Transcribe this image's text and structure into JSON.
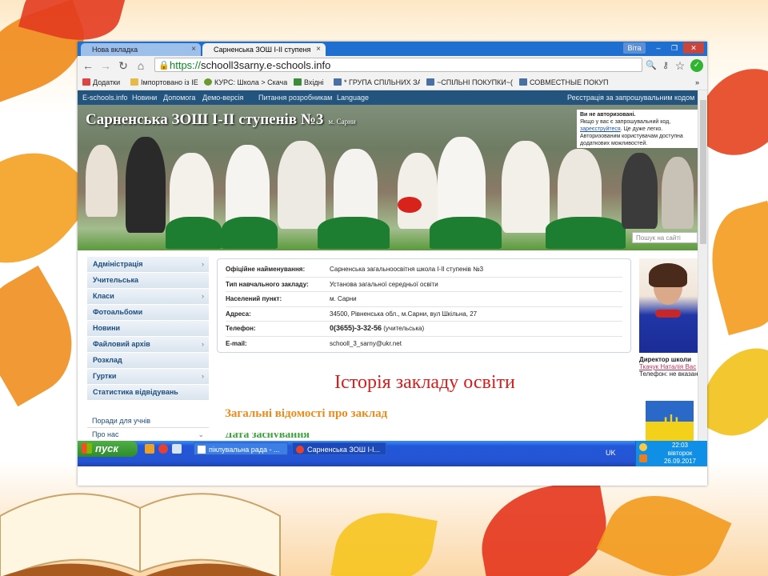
{
  "browser": {
    "tabs": [
      {
        "label": "Нова вкладка"
      },
      {
        "label": "Сарненська ЗОШ І-ІІ ступеня"
      }
    ],
    "user_badge": "Віта",
    "url_scheme": "https://",
    "url_host": "schooll3sarny.e-schools.info",
    "bookmarks": [
      {
        "label": "Додатки"
      },
      {
        "label": "Імпортовано із IE"
      },
      {
        "label": "КУРС: Школа > Скача"
      },
      {
        "label": "Вхідні"
      },
      {
        "label": "* ГРУПА СПІЛЬНИХ ЗА"
      },
      {
        "label": "~СПІЛЬНІ ПОКУПКИ~("
      },
      {
        "label": "СОВМЕСТНЫЕ ПОКУПК"
      }
    ],
    "more": "»"
  },
  "site_nav": {
    "items": [
      "E-schools.info",
      "Новини",
      "Допомога",
      "Демо-версія",
      "Питання розробникам",
      "Language"
    ],
    "register": "Реєстрація за запрошувальним кодом"
  },
  "header": {
    "school_name": "Сарненська ЗОШ І-ІІ ступенів №3",
    "city": "м. Сарни",
    "login_title": "Ви не авторизовані.",
    "login_line1": "Якщо у вас є запрошувальний код,",
    "login_link": "зареєструйтеся",
    "login_line2": ". Це дуже легко.",
    "login_line3": "Авторизованим користувачам доступна",
    "login_line4": "додаткових можливостей.",
    "search_placeholder": "Пошук на сайті"
  },
  "menu": {
    "items": [
      {
        "label": "Адміністрація",
        "arrow": "›"
      },
      {
        "label": "Учительська",
        "arrow": ""
      },
      {
        "label": "Класи",
        "arrow": "›"
      },
      {
        "label": "Фотоальбоми",
        "arrow": ""
      },
      {
        "label": "Новини",
        "arrow": ""
      },
      {
        "label": "Файловий архів",
        "arrow": "›"
      },
      {
        "label": "Розклад",
        "arrow": ""
      },
      {
        "label": "Гуртки",
        "arrow": "›"
      },
      {
        "label": "Статистика відвідувань",
        "arrow": ""
      }
    ],
    "extra": [
      {
        "label": "Поради для учнів"
      },
      {
        "label": "Про нас",
        "arrow": "⌄"
      }
    ]
  },
  "info": {
    "rows": [
      {
        "key": "Офіційне найменування:",
        "value": "Сарненська загальноосвітня школа І-ІІ ступенів №3"
      },
      {
        "key": "Тип навчального закладу:",
        "value": "Установа загальної середньої освіти"
      },
      {
        "key": "Населений пункт:",
        "value": "м. Сарни"
      },
      {
        "key": "Адреса:",
        "value": "34500, Рівненська обл., м.Сарни, вул Шкільна, 27"
      },
      {
        "key": "Телефон:",
        "value": "0(3655)-3-32-56",
        "value_extra": " (учительська)"
      },
      {
        "key": "E-mail:",
        "value": "schooll_3_sarny@ukr.net"
      }
    ]
  },
  "main": {
    "history_title": "Історія закладу освіти",
    "general_title": "Загальні відомості про заклад",
    "green_heading": "Дата заснування"
  },
  "director": {
    "title": "Директор школи",
    "name": "Ткачук Наталія Вас",
    "phone": "Телефон: не вказан"
  },
  "taskbar": {
    "start": "пуск",
    "tasks": [
      {
        "label": "піклувальна рада - ..."
      },
      {
        "label": "Сарненська ЗОШ І-І..."
      }
    ],
    "lang": "UK",
    "time": "22:03",
    "day": "вівторок",
    "date": "26.09.2017"
  },
  "colors": {
    "accent": "#1f6fd1",
    "site_nav": "#23547d",
    "history_title": "#d91c1c",
    "general_title": "#ec8b1c"
  }
}
